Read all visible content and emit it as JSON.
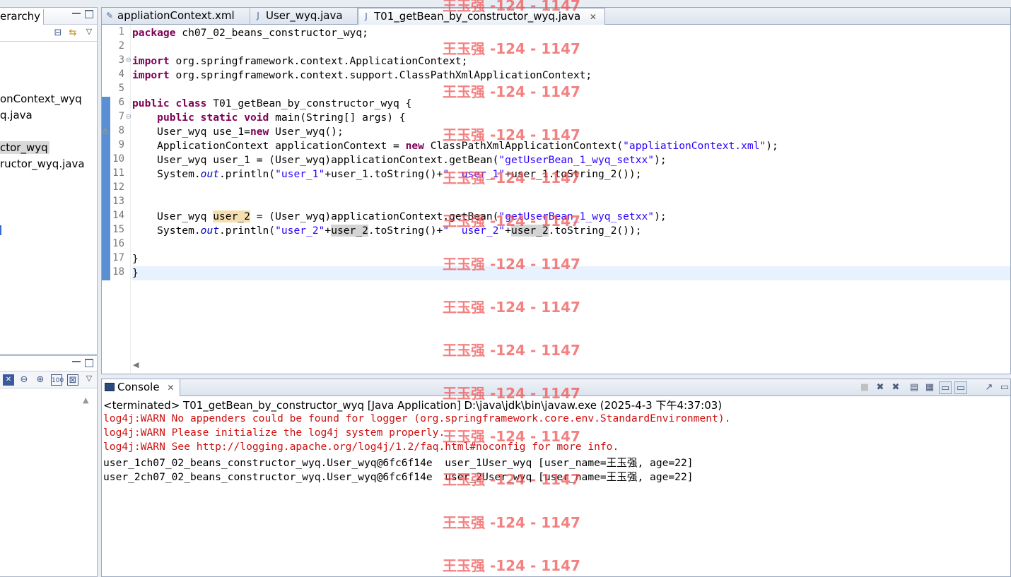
{
  "hierarchy_panel": {
    "tab_label": "erarchy",
    "tree_items": [
      {
        "label": "onContext_wyq",
        "selected": false
      },
      {
        "label": "q.java",
        "selected": false
      },
      {
        "label": "ctor_wyq",
        "selected": true
      },
      {
        "label": "ructor_wyq.java",
        "selected": false
      }
    ]
  },
  "editor": {
    "tabs": [
      {
        "label": "appliationContext.xml",
        "icon": "xml-file-icon",
        "active": false
      },
      {
        "label": "User_wyq.java",
        "icon": "java-file-icon",
        "active": false
      },
      {
        "label": "T01_getBean_by_constructor_wyq.java",
        "icon": "java-file-icon",
        "active": true
      }
    ],
    "close_glyph": "✕",
    "line_numbers": [
      "1",
      "2",
      "3",
      "4",
      "5",
      "6",
      "7",
      "8",
      "9",
      "10",
      "11",
      "12",
      "13",
      "14",
      "15",
      "16",
      "17",
      "18"
    ],
    "lines": [
      [
        {
          "t": "package",
          "c": "kw"
        },
        {
          "t": " ch07_02_beans_constructor_wyq;"
        }
      ],
      [],
      [
        {
          "t": "import",
          "c": "kw"
        },
        {
          "t": " org.springframework.context.ApplicationContext;"
        }
      ],
      [
        {
          "t": "import",
          "c": "kw"
        },
        {
          "t": " org.springframework.context.support.ClassPathXmlApplicationContext;"
        }
      ],
      [],
      [
        {
          "t": "public",
          "c": "kw"
        },
        {
          "t": " "
        },
        {
          "t": "class",
          "c": "kw"
        },
        {
          "t": " T01_getBean_by_constructor_wyq {"
        }
      ],
      [
        {
          "t": "    "
        },
        {
          "t": "public",
          "c": "kw"
        },
        {
          "t": " "
        },
        {
          "t": "static",
          "c": "kw"
        },
        {
          "t": " "
        },
        {
          "t": "void",
          "c": "kw"
        },
        {
          "t": " main(String[] args) {"
        }
      ],
      [
        {
          "t": "    User_wyq use_1="
        },
        {
          "t": "new",
          "c": "kw"
        },
        {
          "t": " User_wyq();"
        }
      ],
      [
        {
          "t": "    ApplicationContext applicationContext = "
        },
        {
          "t": "new",
          "c": "kw"
        },
        {
          "t": " ClassPathXmlApplicationContext("
        },
        {
          "t": "\"appliationContext.xml\"",
          "c": "str"
        },
        {
          "t": ");"
        }
      ],
      [
        {
          "t": "    User_wyq user_1 = (User_wyq)applicationContext.getBean("
        },
        {
          "t": "\"getUserBean_1_wyq_setxx\"",
          "c": "str"
        },
        {
          "t": ");"
        }
      ],
      [
        {
          "t": "    System."
        },
        {
          "t": "out",
          "c": "sfield"
        },
        {
          "t": ".println("
        },
        {
          "t": "\"user_1\"",
          "c": "str"
        },
        {
          "t": "+user_1.toString()+"
        },
        {
          "t": "\"  user_1\"",
          "c": "str"
        },
        {
          "t": "+user_1.toString_2());"
        }
      ],
      [],
      [],
      [
        {
          "t": "    User_wyq "
        },
        {
          "t": "user_2",
          "c": "occ-w"
        },
        {
          "t": " = (User_wyq)applicationContext.getBean("
        },
        {
          "t": "\"getUserBean_1_wyq_setxx\"",
          "c": "str"
        },
        {
          "t": ");"
        }
      ],
      [
        {
          "t": "    System."
        },
        {
          "t": "out",
          "c": "sfield"
        },
        {
          "t": ".println("
        },
        {
          "t": "\"user_2\"",
          "c": "str"
        },
        {
          "t": "+"
        },
        {
          "t": "user_2",
          "c": "occ"
        },
        {
          "t": ".toString()+"
        },
        {
          "t": "\"  user_2\"",
          "c": "str"
        },
        {
          "t": "+"
        },
        {
          "t": "user_2",
          "c": "occ"
        },
        {
          "t": ".toString_2());"
        }
      ],
      [],
      [
        {
          "t": "}"
        }
      ],
      [
        {
          "t": "}"
        }
      ]
    ]
  },
  "console": {
    "tab_label": "Console",
    "terminated_line": "<terminated> T01_getBean_by_constructor_wyq [Java Application] D:\\java\\jdk\\bin\\javaw.exe (2025-4-3 下午4:37:03)",
    "output": [
      {
        "text": "log4j:WARN No appenders could be found for logger (org.springframework.core.env.StandardEnvironment).",
        "type": "err"
      },
      {
        "text": "log4j:WARN Please initialize the log4j system properly.",
        "type": "err"
      },
      {
        "text": "log4j:WARN See http://logging.apache.org/log4j/1.2/faq.html#noconfig for more info.",
        "type": "err"
      },
      {
        "text": "user_1ch07_02_beans_constructor_wyq.User_wyq@6fc6f14e  user_1User_wyq [user_name=王玉强, age=22]",
        "type": "out"
      },
      {
        "text": "user_2ch07_02_beans_constructor_wyq.User_wyq@6fc6f14e  user_2User_wyq [user_name=王玉强, age=22]",
        "type": "out"
      }
    ]
  },
  "watermark": {
    "text": "王玉强 -124 - 1147"
  },
  "colors": {
    "keyword": "#7f0055",
    "string": "#2a00ff",
    "static_field": "#0000c0",
    "console_error": "#d01010",
    "watermark": "#f05050",
    "current_line": "#e8f2fe"
  }
}
